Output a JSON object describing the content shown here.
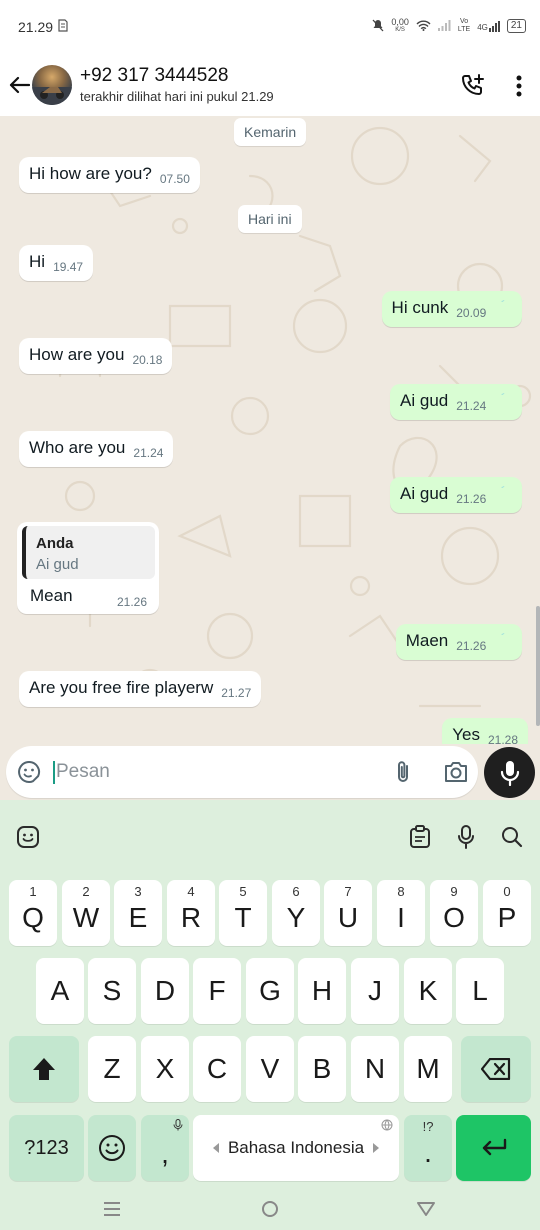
{
  "status_bar": {
    "time": "21.29",
    "net_speed_value": "0,00",
    "net_speed_unit": "K/S",
    "volte_top": "Vo",
    "volte_bottom": "LTE",
    "network": "4G",
    "battery": "21"
  },
  "header": {
    "contact_name": "+92 317 3444528",
    "last_seen": "terakhir dilihat hari ini pukul 21.29"
  },
  "chat": {
    "date_yesterday": "Kemarin",
    "date_today": "Hari ini",
    "messages": [
      {
        "text": "Hi how are you?",
        "time": "07.50",
        "outgoing": false
      },
      {
        "text": "Hi",
        "time": "19.47",
        "outgoing": false
      },
      {
        "text": "Hi cunk",
        "time": "20.09",
        "outgoing": true
      },
      {
        "text": "How are you",
        "time": "20.18",
        "outgoing": false
      },
      {
        "text": "Ai gud",
        "time": "21.24",
        "outgoing": true
      },
      {
        "text": "Who are you",
        "time": "21.24",
        "outgoing": false
      },
      {
        "text": "Ai gud",
        "time": "21.26",
        "outgoing": true
      },
      {
        "text": "Mean",
        "time": "21.26",
        "outgoing": false,
        "quote_author": "Anda",
        "quote_text": "Ai gud"
      },
      {
        "text": "Maen",
        "time": "21.26",
        "outgoing": true
      },
      {
        "text": "Are you free fire playerw",
        "time": "21.27",
        "outgoing": false
      },
      {
        "text": "Yes",
        "time": "21.28",
        "outgoing": true
      }
    ]
  },
  "composer": {
    "placeholder": "Pesan"
  },
  "keyboard": {
    "row1": [
      {
        "key": "Q",
        "hint": "1"
      },
      {
        "key": "W",
        "hint": "2"
      },
      {
        "key": "E",
        "hint": "3"
      },
      {
        "key": "R",
        "hint": "4"
      },
      {
        "key": "T",
        "hint": "5"
      },
      {
        "key": "Y",
        "hint": "6"
      },
      {
        "key": "U",
        "hint": "7"
      },
      {
        "key": "I",
        "hint": "8"
      },
      {
        "key": "O",
        "hint": "9"
      },
      {
        "key": "P",
        "hint": "0"
      }
    ],
    "row2": [
      "A",
      "S",
      "D",
      "F",
      "G",
      "H",
      "J",
      "K",
      "L"
    ],
    "row3": [
      "Z",
      "X",
      "C",
      "V",
      "B",
      "N",
      "M"
    ],
    "symbols_key": "?123",
    "comma_key": ",",
    "space_label": "Bahasa Indonesia",
    "period_key": ".",
    "period_hint": "!?"
  },
  "colors": {
    "incoming_bubble": "#ffffff",
    "outgoing_bubble": "#d9fdd3",
    "read_ticks": "#53bdeb",
    "keyboard_bg": "#ddefdd",
    "enter_key": "#1ec566"
  }
}
